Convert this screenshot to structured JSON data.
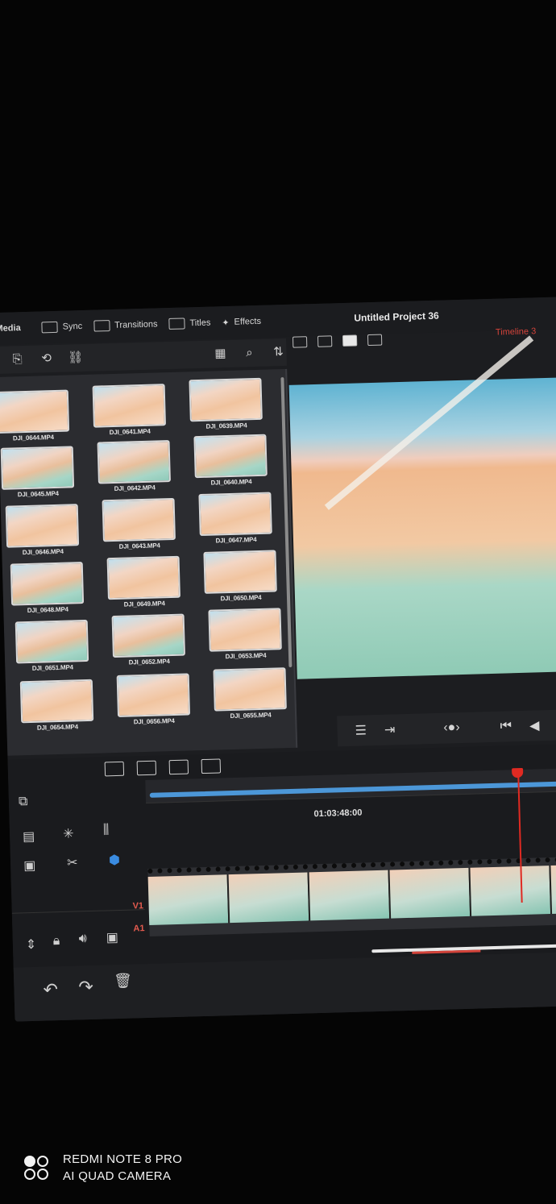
{
  "topbar": {
    "tabs": [
      {
        "label": "Media",
        "icon": "media-pool-icon"
      },
      {
        "label": "Sync",
        "icon": "sync-icon"
      },
      {
        "label": "Transitions",
        "icon": "transitions-icon"
      },
      {
        "label": "Titles",
        "icon": "titles-icon"
      },
      {
        "label": "Effects",
        "icon": "effects-wand-icon"
      }
    ],
    "project_title": "Untitled Project 36",
    "timeline_name": "Timeline 3"
  },
  "media_pool": {
    "clips": [
      {
        "name": "DJI_0644.MP4"
      },
      {
        "name": "DJI_0641.MP4"
      },
      {
        "name": "DJI_0639.MP4"
      },
      {
        "name": "DJI_0645.MP4"
      },
      {
        "name": "DJI_0642.MP4"
      },
      {
        "name": "DJI_0640.MP4"
      },
      {
        "name": "DJI_0646.MP4"
      },
      {
        "name": "DJI_0643.MP4"
      },
      {
        "name": "DJI_0647.MP4"
      },
      {
        "name": "DJI_0648.MP4"
      },
      {
        "name": "DJI_0649.MP4"
      },
      {
        "name": "DJI_0650.MP4"
      },
      {
        "name": "DJI_0651.MP4"
      },
      {
        "name": "DJI_0652.MP4"
      },
      {
        "name": "DJI_0653.MP4"
      },
      {
        "name": "DJI_0654.MP4"
      },
      {
        "name": "DJI_0656.MP4"
      },
      {
        "name": "DJI_0655.MP4"
      }
    ]
  },
  "timeline": {
    "timecode": "01:03:48:00",
    "tracks": {
      "video": "V1",
      "audio": "A1"
    }
  },
  "watermark": {
    "line1": "REDMI NOTE 8 PRO",
    "line2": "AI QUAD CAMERA"
  },
  "colors": {
    "accent_red": "#e02a22",
    "timeline_blue": "#4c97d8",
    "background": "#1c1d20"
  }
}
